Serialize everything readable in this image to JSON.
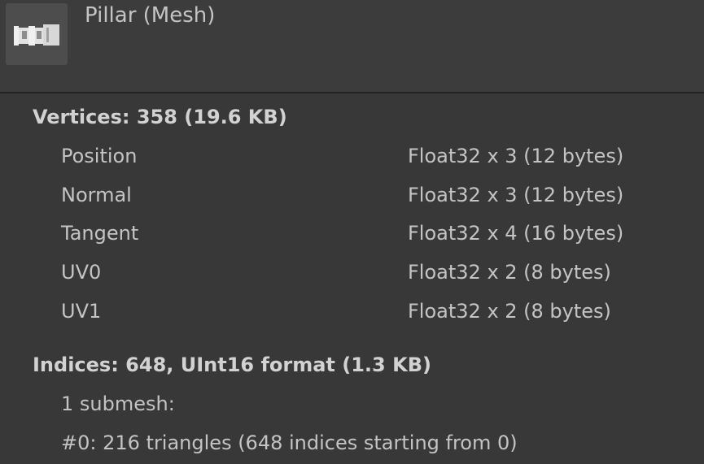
{
  "header": {
    "title": "Pillar (Mesh)",
    "thumbnail_icon": "mesh-preview-icon"
  },
  "vertices": {
    "title": "Vertices: 358 (19.6 KB)",
    "attributes": [
      {
        "name": "Position",
        "format": "Float32 x 3 (12 bytes)"
      },
      {
        "name": "Normal",
        "format": "Float32 x 3 (12 bytes)"
      },
      {
        "name": "Tangent",
        "format": "Float32 x 4 (16 bytes)"
      },
      {
        "name": "UV0",
        "format": "Float32 x 2 (8 bytes)"
      },
      {
        "name": "UV1",
        "format": "Float32 x 2 (8 bytes)"
      }
    ]
  },
  "indices": {
    "title": "Indices: 648, UInt16 format (1.3 KB)",
    "submesh_count": "1 submesh:",
    "submeshes": [
      "#0: 216 triangles (648 indices starting from 0)"
    ]
  },
  "colors": {
    "background": "#383838",
    "header_background": "#3c3c3c",
    "text": "#c4c4c4",
    "title_text": "#d2d2d2"
  }
}
